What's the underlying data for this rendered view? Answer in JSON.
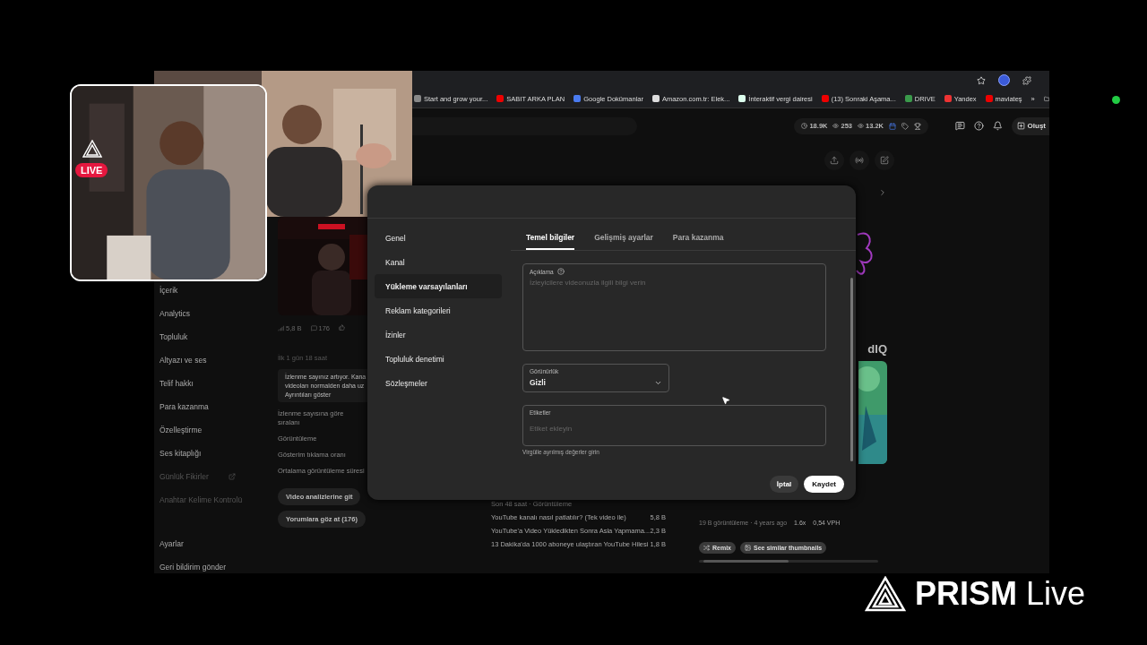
{
  "browser": {
    "bookmarks": [
      {
        "kind": "plain",
        "label": "Start and grow your..."
      },
      {
        "kind": "youtube",
        "label": "SABIT ARKA PLAN"
      },
      {
        "kind": "docs",
        "label": "Google Dokümanlar"
      },
      {
        "kind": "amazon",
        "label": "Amazon.com.tr: Elek..."
      },
      {
        "kind": "tax",
        "label": "İnteraktif vergi dairesi"
      },
      {
        "kind": "youtube",
        "label": "(13) Sonraki Aşama..."
      },
      {
        "kind": "drive",
        "label": "DRIVE"
      },
      {
        "kind": "yandex",
        "label": "Yandex"
      },
      {
        "kind": "youtube",
        "label": "maviateş"
      }
    ],
    "overflow": "»"
  },
  "header": {
    "stats": [
      "18.9K",
      "253",
      "13.2K"
    ],
    "create_button": "Oluşt"
  },
  "sidebar": {
    "items": [
      {
        "label": "İçerik",
        "dimmed": false,
        "external": false
      },
      {
        "label": "Analytics",
        "dimmed": false,
        "external": false
      },
      {
        "label": "Topluluk",
        "dimmed": false,
        "external": false
      },
      {
        "label": "Altyazı ve ses",
        "dimmed": false,
        "external": false
      },
      {
        "label": "Telif hakkı",
        "dimmed": false,
        "external": false
      },
      {
        "label": "Para kazanma",
        "dimmed": false,
        "external": false
      },
      {
        "label": "Özelleştirme",
        "dimmed": false,
        "external": false
      },
      {
        "label": "Ses kitaplığı",
        "dimmed": false,
        "external": false
      },
      {
        "label": "Günlük Fikirler",
        "dimmed": true,
        "external": true
      },
      {
        "label": "Anahtar Kelime Kontrolü",
        "dimmed": true,
        "external": false
      }
    ],
    "footer_items": [
      "Ayarlar",
      "Geri bildirim gönder"
    ]
  },
  "video_card": {
    "stats": [
      "5,8 B",
      "176"
    ],
    "age": "İlk 1 gün 18 saat",
    "notice": {
      "lines": [
        "İzlenme sayınız artıyor. Kana",
        "videoları normalden daha uz"
      ],
      "link": "Ayrıntıları göster"
    },
    "metrics": [
      "İzlenme sayısına göre sıralanı",
      "Görüntüleme",
      "Gösterim tıklama oranı",
      "Ortalama görüntüleme süresi"
    ],
    "buttons": [
      "Video analizlerine git",
      "Yorumlara göz at (176)"
    ]
  },
  "top_videos": {
    "subtitle": "Son 48 saat · Görüntüleme",
    "rows": [
      {
        "title": "YouTube kanalı nasıl patlatılır? (Tek video ile)",
        "views": "5,8 B"
      },
      {
        "title": "YouTube'a Video Yükledikten Sonra Asla Yapmama...",
        "views": "2,3 B"
      },
      {
        "title": "13 Dakika'da 1000 aboneye ulaştıran YouTube Hilesi",
        "views": "1,8 B"
      }
    ]
  },
  "suggestion": {
    "logo": "dIQ",
    "meta": "19 B görüntüleme · 4 years ago",
    "ratio": "1.6x",
    "vph": "0,54 VPH",
    "buttons": [
      "Remix",
      "See similar thumbnails"
    ]
  },
  "dialog": {
    "nav": [
      {
        "label": "Genel",
        "selected": false
      },
      {
        "label": "Kanal",
        "selected": false
      },
      {
        "label": "Yükleme varsayılanları",
        "selected": true
      },
      {
        "label": "Reklam kategorileri",
        "selected": false
      },
      {
        "label": "İzinler",
        "selected": false
      },
      {
        "label": "Topluluk denetimi",
        "selected": false
      },
      {
        "label": "Sözleşmeler",
        "selected": false
      }
    ],
    "tabs": [
      {
        "label": "Temel bilgiler",
        "selected": true
      },
      {
        "label": "Gelişmiş ayarlar",
        "selected": false
      },
      {
        "label": "Para kazanma",
        "selected": false
      }
    ],
    "description": {
      "label": "Açıklama",
      "placeholder": "İzleyicilere videonuzla ilgili bilgi verin"
    },
    "visibility": {
      "label": "Görünürlük",
      "value": "Gizli"
    },
    "tags": {
      "label": "Etiketler",
      "placeholder": "Etiket ekleyin",
      "hint": "Virgülle ayrılmış değerler girin"
    },
    "cancel": "İptal",
    "save": "Kaydet"
  },
  "stream": {
    "badge": "LIVE",
    "brand": "PRISM",
    "brand_suffix": "Live"
  }
}
